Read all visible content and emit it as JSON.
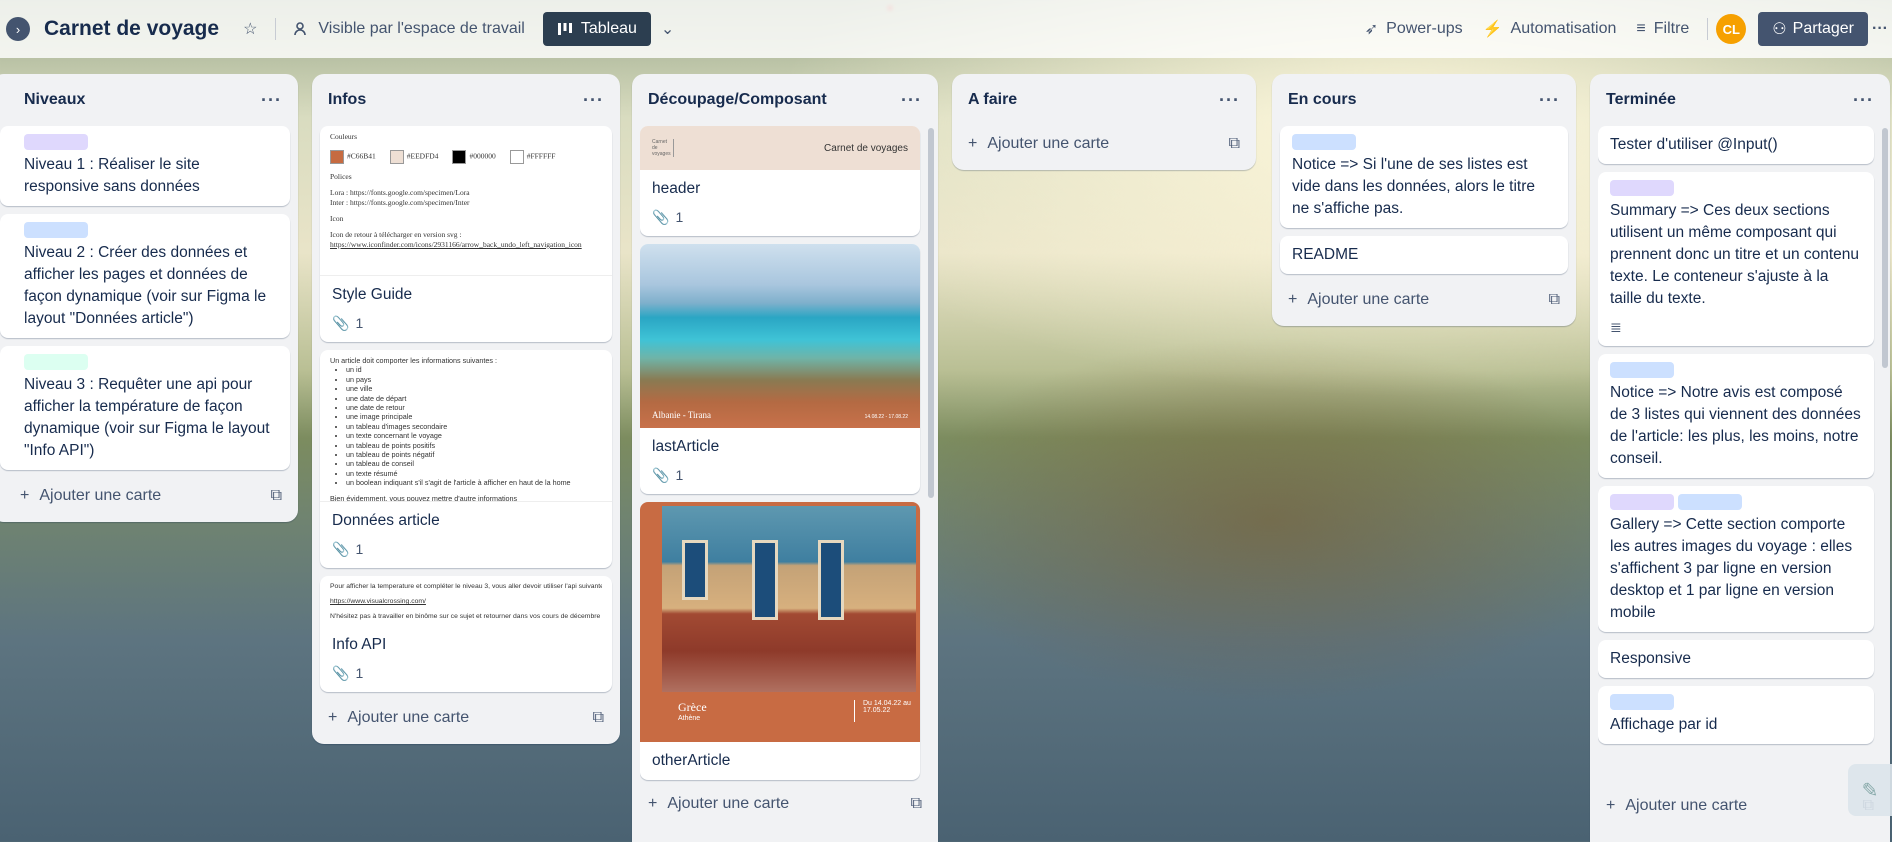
{
  "header": {
    "board_title": "Carnet de voyage",
    "visibility": "Visible par l'espace de travail",
    "view_label": "Tableau",
    "powerups": "Power-ups",
    "automation": "Automatisation",
    "filter": "Filtre",
    "avatar_initials": "CL",
    "share": "Partager"
  },
  "add_card_label": "Ajouter une carte",
  "lists": {
    "niveaux": {
      "title": "Niveaux",
      "cards": [
        {
          "text": "Niveau 1 : Réaliser le site responsive sans données",
          "label_color": "#dfd8fd"
        },
        {
          "text": "Niveau 2 : Créer des données et afficher les pages et données de façon dynamique (voir sur Figma le layout \"Données article\")",
          "label_color": "#cce0ff"
        },
        {
          "text": "Niveau 3 : Requêter une api pour afficher la température de façon dynamique (voir sur Figma le layout \"Info API\")",
          "label_color": "#dcfff1"
        }
      ]
    },
    "infos": {
      "title": "Infos",
      "cards": [
        {
          "title": "Style Guide",
          "attachments": "1",
          "doc": {
            "couleurs": "Couleurs",
            "c1": "#C66B41",
            "c2": "#EEDFD4",
            "c3": "#000000",
            "c4": "#FFFFFF",
            "polices": "Polices",
            "lora": "Lora : https://fonts.google.com/specimen/Lora",
            "inter": "Inter : https://fonts.google.com/specimen/Inter",
            "icon": "Icon",
            "icon_desc": "Icon de retour à télécharger en version svg :",
            "icon_url": "https://www.iconfinder.com/icons/2931166/arrow_back_undo_left_navigation_icon"
          }
        },
        {
          "title": "Données article",
          "attachments": "1",
          "doc": {
            "intro": "Un article doit comporter les informations suivantes :",
            "items": [
              "un id",
              "un pays",
              "une ville",
              "une date de départ",
              "une date de retour",
              "une image principale",
              "un tableau d'images secondaire",
              "un texte concernant le voyage",
              "un tableau de points positifs",
              "un tableau de points négatif",
              "un tableau de conseil",
              "un texte résumé",
              "un boolean indiquant s'il s'agit de l'article à afficher en haut de la home"
            ],
            "outro": "Bien évidemment, vous pouvez mettre d'autre informations"
          }
        },
        {
          "title": "Info API",
          "attachments": "1",
          "doc": {
            "l1": "Pour afficher la temperature et compléter le niveau 3, vous aller devoir utiliser l'api suivante :",
            "l2": "https://www.visualcrossing.com/",
            "l3": "N'hésitez pas à travailler en binôme sur ce sujet et retourner dans vos cours de décembre :)"
          }
        }
      ]
    },
    "decoupage": {
      "title": "Découpage/Composant",
      "cards": [
        {
          "title": "header",
          "attachments": "1",
          "cover_text": "Carnet de voyages",
          "cover_logo": "Carnet de voyages"
        },
        {
          "title": "lastArticle",
          "attachments": "1",
          "cover_caption": "Albanie - Tirana",
          "cover_dates": "14.08.22 - 17.08.22"
        },
        {
          "title": "otherArticle",
          "cover_country": "Grèce",
          "cover_city": "Athène",
          "cover_dates": "Du 14.04.22 au 17.05.22"
        }
      ]
    },
    "a_faire": {
      "title": "A faire"
    },
    "en_cours": {
      "title": "En cours",
      "cards": [
        {
          "text": "Notice => Si l'une de ses listes est vide dans les données, alors le titre ne s'affiche pas.",
          "label_color": "#cce0ff"
        },
        {
          "text": "README"
        }
      ]
    },
    "terminee": {
      "title": "Terminée",
      "cards": [
        {
          "text": "Tester d'utiliser @Input()"
        },
        {
          "text": "Summary => Ces deux sections utilisent un même composant qui prennent donc un titre et un contenu texte. Le conteneur s'ajuste à la taille du texte.",
          "label_color": "#dfd8fd"
        },
        {
          "text": "Notice => Notre avis est composé de 3 listes qui viennent des données de l'article: les plus, les moins, notre conseil.",
          "label_color": "#cce0ff"
        },
        {
          "text": "Gallery => Cette section comporte les autres images du voyage : elles s'affichent 3 par ligne en version desktop et 1 par ligne en version mobile",
          "label_colors": [
            "#dfd8fd",
            "#cce0ff"
          ]
        },
        {
          "text": "Responsive"
        },
        {
          "text": "Affichage par id",
          "label_color": "#cce0ff"
        }
      ]
    }
  }
}
